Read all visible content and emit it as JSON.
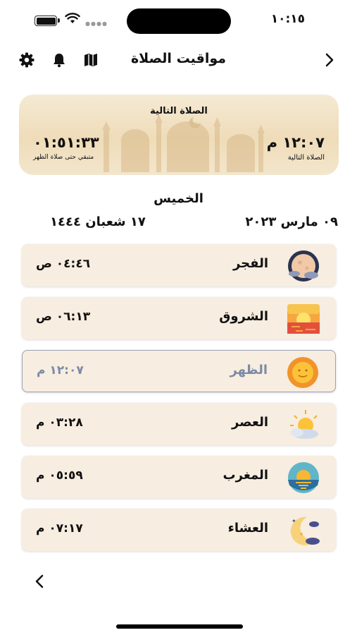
{
  "status_bar": {
    "time": "١٠:١٥"
  },
  "nav": {
    "title": "مواقيت الصلاة",
    "icons": [
      "gear-icon",
      "bell-icon",
      "map-icon",
      "chevron-right-icon"
    ]
  },
  "next_prayer_card": {
    "title": "الصلاة التالية",
    "prayer_time": "١٢:٠٧ م",
    "prayer_time_label": "الصلاة التالية",
    "countdown": "٠١:٥١:٣٣",
    "countdown_label": "متبقي حتى صلاة الظهر"
  },
  "dates": {
    "day_name": "الخميس",
    "gregorian": "٠٩ مارس ٢٠٢٣",
    "hijri": "١٧ شعبان ١٤٤٤"
  },
  "prayers": [
    {
      "name": "الفجر",
      "time": "٠٤:٤٦ ص",
      "icon": "moon-clouds-icon",
      "active": false
    },
    {
      "name": "الشروق",
      "time": "٠٦:١٣ ص",
      "icon": "sunrise-icon",
      "active": false
    },
    {
      "name": "الظهر",
      "time": "١٢:٠٧ م",
      "icon": "sun-icon",
      "active": true
    },
    {
      "name": "العصر",
      "time": "٠٣:٢٨ م",
      "icon": "sun-cloud-icon",
      "active": false
    },
    {
      "name": "المغرب",
      "time": "٠٥:٥٩ م",
      "icon": "sunset-sea-icon",
      "active": false
    },
    {
      "name": "العشاء",
      "time": "٠٧:١٧ م",
      "icon": "crescent-moon-icon",
      "active": false
    }
  ],
  "colors": {
    "card_bg": "#f7ede0",
    "active_text": "#7c8aa6",
    "active_border": "#9aa3b5"
  }
}
